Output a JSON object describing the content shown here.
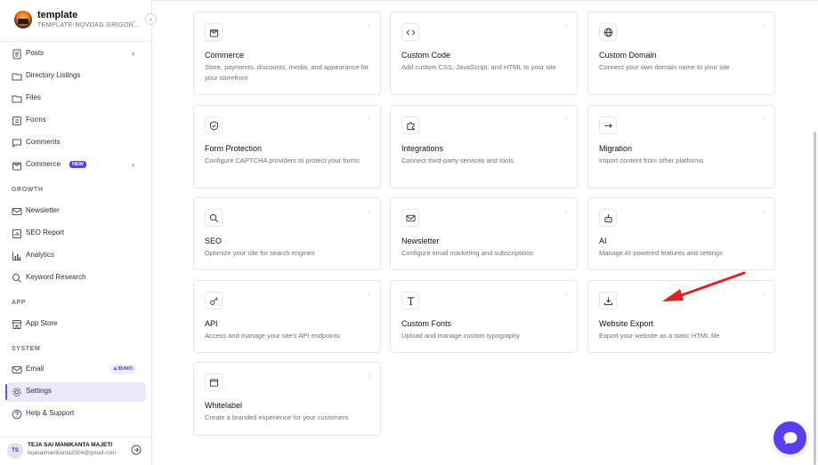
{
  "workspace": {
    "name": "template",
    "subdomain": "TEMPLATE-NQVDAG.GRIGOR..."
  },
  "sidebar": {
    "items": [
      {
        "label": "Posts",
        "icon": "document-icon",
        "has_arrow": true
      },
      {
        "label": "Directory Listings",
        "icon": "folder-icon"
      },
      {
        "label": "Files",
        "icon": "folder-icon"
      },
      {
        "label": "Forms",
        "icon": "form-icon"
      },
      {
        "label": "Comments",
        "icon": "comment-icon"
      },
      {
        "label": "Commerce",
        "icon": "bag-icon",
        "badge": "NEW",
        "has_arrow": true
      }
    ],
    "growth_label": "GROWTH",
    "growth_items": [
      {
        "label": "Newsletter",
        "icon": "mail-icon"
      },
      {
        "label": "SEO Report",
        "icon": "report-icon"
      },
      {
        "label": "Analytics",
        "icon": "chart-icon"
      },
      {
        "label": "Keyword Research",
        "icon": "search-icon"
      }
    ],
    "app_label": "APP",
    "app_items": [
      {
        "label": "App Store",
        "icon": "store-icon"
      }
    ],
    "system_label": "SYSTEM",
    "system_items": [
      {
        "label": "Email",
        "icon": "mail-icon",
        "price_badge": "$5/MO"
      },
      {
        "label": "Settings",
        "icon": "gear-icon",
        "active": true
      },
      {
        "label": "Help & Support",
        "icon": "help-icon"
      }
    ]
  },
  "user": {
    "initials": "TS",
    "name": "TEJA SAI MANIKANTA MAJETI",
    "email": "tejasaimanikanta2004@gmail.com"
  },
  "cards": [
    {
      "title": "Commerce",
      "description": "Store, payments, discounts, media, and appearance for your storefront",
      "icon": "bag-icon"
    },
    {
      "title": "Custom Code",
      "description": "Add custom CSS, JavaScript, and HTML to your site",
      "icon": "code-icon"
    },
    {
      "title": "Custom Domain",
      "description": "Connect your own domain name to your site",
      "icon": "globe-icon"
    },
    {
      "title": "Form Protection",
      "description": "Configure CAPTCHA providers to protect your forms",
      "icon": "shield-icon"
    },
    {
      "title": "Integrations",
      "description": "Connect third-party services and tools",
      "icon": "puzzle-icon"
    },
    {
      "title": "Migration",
      "description": "Import content from other platforms",
      "icon": "arrow-right-icon"
    },
    {
      "title": "SEO",
      "description": "Optimize your site for search engines",
      "icon": "search-icon"
    },
    {
      "title": "Newsletter",
      "description": "Configure email marketing and subscriptions",
      "icon": "mail-icon"
    },
    {
      "title": "AI",
      "description": "Manage AI-powered features and settings",
      "icon": "robot-icon"
    },
    {
      "title": "API",
      "description": "Access and manage your site's API endpoints",
      "icon": "key-icon"
    },
    {
      "title": "Custom Fonts",
      "description": "Upload and manage custom typography",
      "icon": "type-icon"
    },
    {
      "title": "Website Export",
      "description": "Export your website as a static HTML file",
      "icon": "download-icon"
    },
    {
      "title": "Whitelabel",
      "description": "Create a branded experience for your customers",
      "icon": "window-icon"
    }
  ],
  "colors": {
    "accent": "#5b3df5",
    "annotation_arrow": "#e02424"
  }
}
